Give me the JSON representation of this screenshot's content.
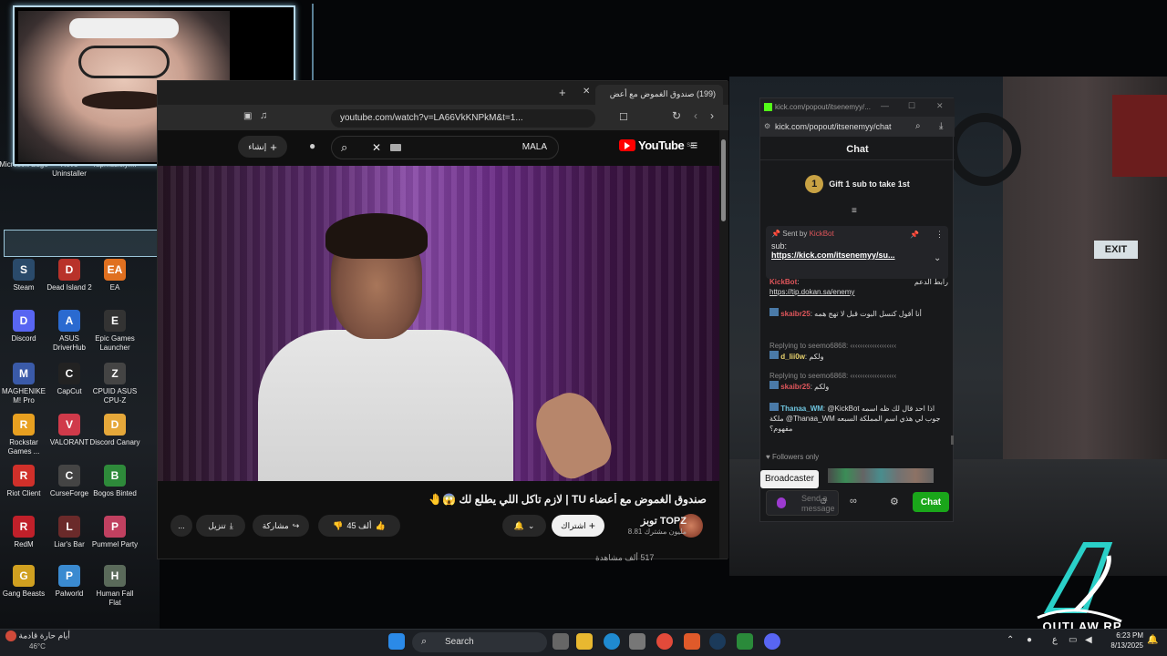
{
  "desktop": {
    "icons": [
      {
        "label": "Microsoft Edge",
        "color": "#1f7fd0",
        "glyph": "e"
      },
      {
        "label": "Revo Uninstaller",
        "color": "#c0392b",
        "glyph": "R"
      },
      {
        "label": "rapmusiclyr...",
        "color": "#555555",
        "glyph": "♪"
      },
      {
        "label": "Steam",
        "color": "#2a4a6a",
        "glyph": "S"
      },
      {
        "label": "Dead Island 2",
        "color": "#b8322a",
        "glyph": "D"
      },
      {
        "label": "EA",
        "color": "#e07020",
        "glyph": "EA"
      },
      {
        "label": "Discord",
        "color": "#5865f2",
        "glyph": "D"
      },
      {
        "label": "ASUS DriverHub",
        "color": "#2a6ad0",
        "glyph": "A"
      },
      {
        "label": "Epic Games Launcher",
        "color": "#333333",
        "glyph": "E"
      },
      {
        "label": "MAGHENIKE M! Pro",
        "color": "#3a5aa8",
        "glyph": "M"
      },
      {
        "label": "CapCut",
        "color": "#222222",
        "glyph": "C"
      },
      {
        "label": "CPUID ASUS CPU-Z",
        "color": "#444444",
        "glyph": "Z"
      },
      {
        "label": "Rockstar Games ...",
        "color": "#e8a020",
        "glyph": "R"
      },
      {
        "label": "VALORANT",
        "color": "#d03a4a",
        "glyph": "V"
      },
      {
        "label": "Discord Canary",
        "color": "#e6a83a",
        "glyph": "D"
      },
      {
        "label": "Riot Client",
        "color": "#d0302a",
        "glyph": "R"
      },
      {
        "label": "CurseForge",
        "color": "#444444",
        "glyph": "C"
      },
      {
        "label": "Bogos Binted",
        "color": "#2e8a3a",
        "glyph": "B"
      },
      {
        "label": "RedM",
        "color": "#c0202a",
        "glyph": "R"
      },
      {
        "label": "Liar's Bar",
        "color": "#6a2a2a",
        "glyph": "L"
      },
      {
        "label": "Pummel Party",
        "color": "#c04060",
        "glyph": "P"
      },
      {
        "label": "Gang Beasts",
        "color": "#d0a020",
        "glyph": "G"
      },
      {
        "label": "Palworld",
        "color": "#3a8ad0",
        "glyph": "P"
      },
      {
        "label": "Human Fall Flat",
        "color": "#5a6a5a",
        "glyph": "H"
      }
    ]
  },
  "browser": {
    "tab_title": "(199) صندوق الغموض مع أعض",
    "url": "youtube.com/watch?v=LA66VkKNPkM&t=1...",
    "logo": "YouTube",
    "logo_region": "SA",
    "search_value": "MALA",
    "create_label": "إنشاء",
    "video_title": "صندوق الغموض مع أعضاء TU | لازم تاكل اللي يطلع لك 😱🤚",
    "channel_name": "توبز TOPZ",
    "channel_subs": "8.81 مليون مشترك",
    "subscribe_label": "اشتراك",
    "like_count": "45 ألف",
    "share_label": "مشاركة",
    "download_label": "تنزيل",
    "more_label": "...",
    "below_text": "517 ألف مشاهدة"
  },
  "chat": {
    "window_title": "kick.com/popout/itsenemyy/...",
    "url": "kick.com/popout/itsenemyy/chat",
    "header": "Chat",
    "gift_num": "1",
    "gift_text": "Gift 1 sub to take 1st",
    "pinned": {
      "sent_by_label": "Sent by",
      "bot_name": "KickBot",
      "line1": "sub:",
      "link": "https://kick.com/itsenemyy/su..."
    },
    "messages": [
      {
        "user": "KickBot",
        "sep": ":",
        "text": "رابط الدعم",
        "link": "https://tip.dokan.sa/enemy"
      },
      {
        "user": "skaibr25",
        "sep": ":",
        "text": "أنا أقول كنسل البوت قبل لا تهج همه"
      },
      {
        "reply": "Replying to seemo6868: ‹‹‹‹‹‹‹‹‹‹‹‹‹‹‹‹‹‹‹",
        "user": "d_lii0w",
        "sep": ":",
        "text": "ولكم"
      },
      {
        "reply": "Replying to seemo6868: ‹‹‹‹‹‹‹‹‹‹‹‹‹‹‹‹‹‹‹",
        "user": "skaibr25",
        "sep": ":",
        "text": "ولكم"
      },
      {
        "user": "Thanaa_WM",
        "sep": ":",
        "text": "@KickBot اذا احد قال لك ظه اسمه ملكة @Thanaa_WM جوب لي هذي اسم المملكة السبعه مفهوم؟"
      }
    ],
    "followers_only": "Followers only",
    "tooltip": "Broadcaster",
    "send_placeholder": "Send a message",
    "chat_button": "Chat"
  },
  "overlay": {
    "logo_text": "OUTLAW RP"
  },
  "taskbar": {
    "weather_text": "أيام حارة قادمة",
    "weather_temp": "46°C",
    "search_placeholder": "Search",
    "time": "6:23 PM",
    "date": "8/13/2025",
    "lang": "ع"
  }
}
